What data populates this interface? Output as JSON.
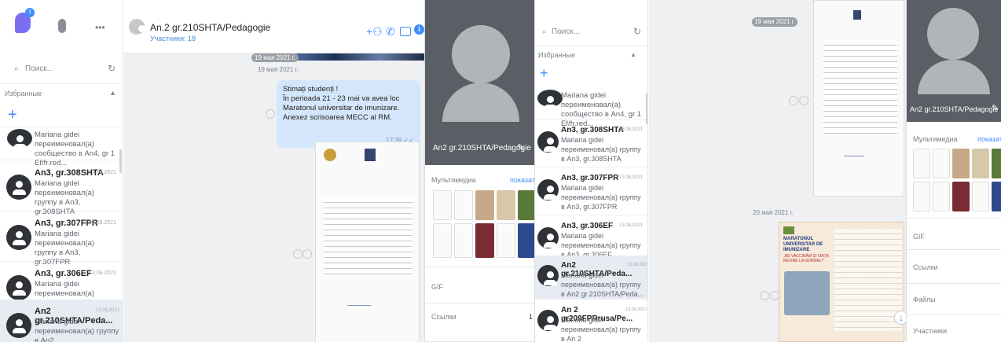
{
  "chat_list": {
    "search": {
      "placeholder": "Поиск..."
    },
    "favorites_label": "Избранные",
    "items": [
      {
        "title": "",
        "date": "",
        "preview": "Mariana gidei переименовал(а) сообщество в An4, gr 1 Ef/fr.red..."
      },
      {
        "title": "An3, gr.308SHTA",
        "date": "13.08.2021",
        "preview": "Mariana gidei переименовал(а) группу в An3, gr.308SHTA"
      },
      {
        "title": "An3, gr.307FPR",
        "date": "13.08.2021",
        "preview": "Mariana gidei переименовал(а) группу в An3, gr.307FPR"
      },
      {
        "title": "An3, gr.306EF",
        "date": "13.08.2021",
        "preview": "Mariana gidei переименовал(а) группу в An3, gr.306EF"
      },
      {
        "title": "An2 gr.210SHTA/Peda...",
        "date": "13.08.2021",
        "preview": "Mariana gidei переименовал(а) группу в An2 gr.210SHTA/Peda..."
      },
      {
        "title": "An 2 gr209FPRrusa/Pe...",
        "date": "13.08.2021",
        "preview": "Mariana gidei переименовал(а) группу в An 2 gr209FPRrusa/Ped..."
      }
    ]
  },
  "chat": {
    "title": "An.2 gr.210SHTA/Pedagogie",
    "members": "Участники: 18",
    "date_pill": "19 мая 2021 г.",
    "message": {
      "lines": [
        "Stimați studenți !",
        "În perioada 21 - 23 mai va avea loc Maratonul universitar de imunizare. Anexez scrisoarea MECC al RM."
      ],
      "time": "17:39"
    }
  },
  "info": {
    "name": "An2 gr.210SHTA/Pedagogie",
    "media_label": "Мультимедиа",
    "show_all": "показать все",
    "gif_label": "GIF",
    "links_label": "Ссылки",
    "links_count": "1",
    "files_label": "Файлы",
    "members_label": "Участники"
  },
  "right_chat": {
    "date_pill_1": "19 мая 2021 г.",
    "date_pill_2": "20 мая 2021 г.",
    "poster_title": "MARATONUL UNIVERSITAR DE IMUNIZARE",
    "poster_sub": "„NE VACCINĂM ȘI VIAȚA REVINE LA NORMAL!”"
  }
}
